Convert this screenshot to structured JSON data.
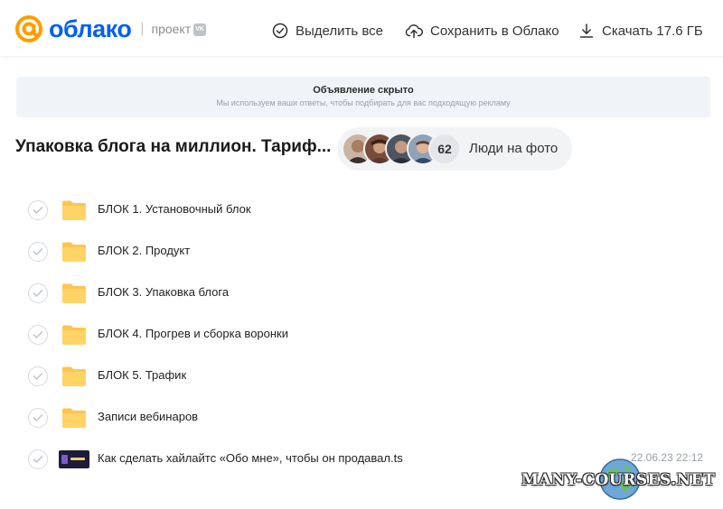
{
  "brand": {
    "logo_text": "облако",
    "separator": "|",
    "subtitle": "проект",
    "vk_badge": "VK",
    "accent": "#005ff9",
    "logo_mark_color": "#ff9e00"
  },
  "header": {
    "select_all": "Выделить все",
    "save_to_cloud": "Сохранить в Облако",
    "download": "Скачать 17.6 ГБ"
  },
  "ad": {
    "title": "Объявление скрыто",
    "subtitle": "Мы используем ваши ответы, чтобы подбирать для вас подходящую рекламу"
  },
  "folder": {
    "title": "Упаковка блога на миллион. Тариф..."
  },
  "people": {
    "count": "62",
    "label": "Люди на фото"
  },
  "files": [
    {
      "name": "БЛОК 1. Установочный блок",
      "type": "folder",
      "date": ""
    },
    {
      "name": "БЛОК 2. Продукт",
      "type": "folder",
      "date": ""
    },
    {
      "name": "БЛОК 3. Упаковка блога",
      "type": "folder",
      "date": ""
    },
    {
      "name": "БЛОК 4. Прогрев и сборка воронки",
      "type": "folder",
      "date": ""
    },
    {
      "name": "БЛОК 5. Трафик",
      "type": "folder",
      "date": ""
    },
    {
      "name": "Записи вебинаров",
      "type": "folder",
      "date": ""
    },
    {
      "name": "Как сделать хайлайтс «Обо мне», чтобы он продавал.ts",
      "type": "video",
      "date": "22.06.23 22:12"
    }
  ],
  "watermark": {
    "text": "MANY-COURSES.NET"
  }
}
